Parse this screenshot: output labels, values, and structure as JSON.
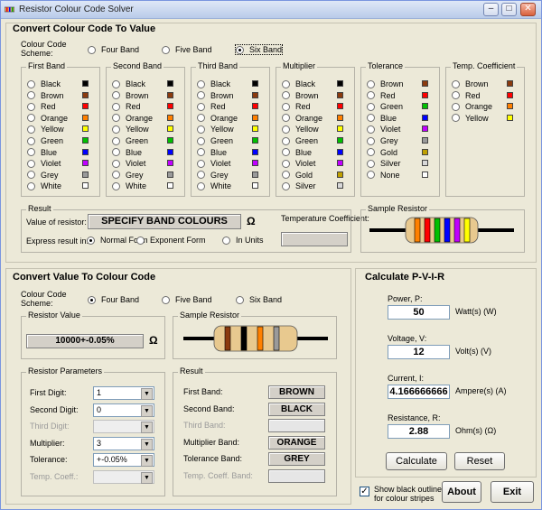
{
  "window": {
    "title": "Resistor Colour Code Solver"
  },
  "top": {
    "title": "Convert Colour Code To Value",
    "scheme_label": "Colour Code Scheme:",
    "schemes": [
      "Four Band",
      "Five Band",
      "Six Band"
    ],
    "selected_scheme": "Six Band",
    "groups": [
      {
        "title": "First Band",
        "items": [
          {
            "label": "Black",
            "color": "#000000"
          },
          {
            "label": "Brown",
            "color": "#8b3a0e"
          },
          {
            "label": "Red",
            "color": "#ff0000"
          },
          {
            "label": "Orange",
            "color": "#ff8000"
          },
          {
            "label": "Yellow",
            "color": "#ffff00"
          },
          {
            "label": "Green",
            "color": "#00c000"
          },
          {
            "label": "Blue",
            "color": "#0000ff"
          },
          {
            "label": "Violet",
            "color": "#c000ff"
          },
          {
            "label": "Grey",
            "color": "#9a9a9a"
          },
          {
            "label": "White",
            "color": "#ffffff"
          }
        ]
      },
      {
        "title": "Second Band",
        "items": [
          {
            "label": "Black",
            "color": "#000000"
          },
          {
            "label": "Brown",
            "color": "#8b3a0e"
          },
          {
            "label": "Red",
            "color": "#ff0000"
          },
          {
            "label": "Orange",
            "color": "#ff8000"
          },
          {
            "label": "Yellow",
            "color": "#ffff00"
          },
          {
            "label": "Green",
            "color": "#00c000"
          },
          {
            "label": "Blue",
            "color": "#0000ff"
          },
          {
            "label": "Violet",
            "color": "#c000ff"
          },
          {
            "label": "Grey",
            "color": "#9a9a9a"
          },
          {
            "label": "White",
            "color": "#ffffff"
          }
        ]
      },
      {
        "title": "Third Band",
        "items": [
          {
            "label": "Black",
            "color": "#000000"
          },
          {
            "label": "Brown",
            "color": "#8b3a0e"
          },
          {
            "label": "Red",
            "color": "#ff0000"
          },
          {
            "label": "Orange",
            "color": "#ff8000"
          },
          {
            "label": "Yellow",
            "color": "#ffff00"
          },
          {
            "label": "Green",
            "color": "#00c000"
          },
          {
            "label": "Blue",
            "color": "#0000ff"
          },
          {
            "label": "Violet",
            "color": "#c000ff"
          },
          {
            "label": "Grey",
            "color": "#9a9a9a"
          },
          {
            "label": "White",
            "color": "#ffffff"
          }
        ]
      },
      {
        "title": "Multiplier",
        "items": [
          {
            "label": "Black",
            "color": "#000000"
          },
          {
            "label": "Brown",
            "color": "#8b3a0e"
          },
          {
            "label": "Red",
            "color": "#ff0000"
          },
          {
            "label": "Orange",
            "color": "#ff8000"
          },
          {
            "label": "Yellow",
            "color": "#ffff00"
          },
          {
            "label": "Green",
            "color": "#00c000"
          },
          {
            "label": "Blue",
            "color": "#0000ff"
          },
          {
            "label": "Violet",
            "color": "#c000ff"
          },
          {
            "label": "Gold",
            "color": "#c0a000"
          },
          {
            "label": "Silver",
            "color": "#d8d8d8"
          }
        ]
      },
      {
        "title": "Tolerance",
        "items": [
          {
            "label": "Brown",
            "color": "#8b3a0e"
          },
          {
            "label": "Red",
            "color": "#ff0000"
          },
          {
            "label": "Green",
            "color": "#00c000"
          },
          {
            "label": "Blue",
            "color": "#0000ff"
          },
          {
            "label": "Violet",
            "color": "#c000ff"
          },
          {
            "label": "Grey",
            "color": "#9a9a9a"
          },
          {
            "label": "Gold",
            "color": "#c0a000"
          },
          {
            "label": "Silver",
            "color": "#d8d8d8"
          },
          {
            "label": "None",
            "color": "#ffffff"
          }
        ]
      },
      {
        "title": "Temp. Coefficient",
        "items": [
          {
            "label": "Brown",
            "color": "#8b3a0e"
          },
          {
            "label": "Red",
            "color": "#ff0000"
          },
          {
            "label": "Orange",
            "color": "#ff8000"
          },
          {
            "label": "Yellow",
            "color": "#ffff00"
          }
        ]
      }
    ],
    "result": {
      "title": "Result",
      "value_label": "Value of resistor:",
      "value": "SPECIFY BAND COLOURS",
      "unit": "Ω",
      "temp_label": "Temperature Coefficient:",
      "temp_value": "",
      "express_label": "Express result in:",
      "express_options": [
        "Normal Form",
        "Exponent Form",
        "In Units"
      ],
      "express_selected": "Normal Form"
    },
    "sample": {
      "title": "Sample Resistor",
      "bands": [
        "#ff8000",
        "#ff0000",
        "#00c000",
        "#0000ff",
        "#c000ff",
        "#ffff00"
      ]
    }
  },
  "bottom": {
    "title": "Convert Value To Colour Code",
    "scheme_label": "Colour Code Scheme:",
    "schemes": [
      "Four Band",
      "Five Band",
      "Six Band"
    ],
    "selected_scheme": "Four Band",
    "value_group": {
      "title": "Resistor Value",
      "value": "10000+-0.05%",
      "unit": "Ω"
    },
    "sample": {
      "title": "Sample Resistor",
      "bands": [
        "#8b3a0e",
        "#000000",
        "#ff8000",
        "#9a9a9a"
      ]
    },
    "params": {
      "title": "Resistor Parameters",
      "rows": [
        {
          "label": "First Digit:",
          "value": "1",
          "enabled": true
        },
        {
          "label": "Second Digit:",
          "value": "0",
          "enabled": true
        },
        {
          "label": "Third Digit:",
          "value": "",
          "enabled": false
        },
        {
          "label": "Multiplier:",
          "value": "3",
          "enabled": true
        },
        {
          "label": "Tolerance:",
          "value": "+-0.05%",
          "enabled": true
        },
        {
          "label": "Temp. Coeff.:",
          "value": "",
          "enabled": false
        }
      ]
    },
    "result": {
      "title": "Result",
      "rows": [
        {
          "label": "First Band:",
          "value": "BROWN",
          "enabled": true
        },
        {
          "label": "Second Band:",
          "value": "BLACK",
          "enabled": true
        },
        {
          "label": "Third Band:",
          "value": "",
          "enabled": false
        },
        {
          "label": "Multiplier Band:",
          "value": "ORANGE",
          "enabled": true
        },
        {
          "label": "Tolerance Band:",
          "value": "GREY",
          "enabled": true
        },
        {
          "label": "Temp. Coeff. Band:",
          "value": "",
          "enabled": false
        }
      ]
    }
  },
  "pvir": {
    "title": "Calculate P-V-I-R",
    "rows": [
      {
        "label": "Power, P:",
        "value": "50",
        "unit": "Watt(s) (W)"
      },
      {
        "label": "Voltage, V:",
        "value": "12",
        "unit": "Volt(s) (V)"
      },
      {
        "label": "Current, I:",
        "value": "4.166666666",
        "unit": "Ampere(s) (A)"
      },
      {
        "label": "Resistance, R:",
        "value": "2.88",
        "unit": "Ohm(s) (Ω)"
      }
    ],
    "calculate": "Calculate",
    "reset": "Reset"
  },
  "footer": {
    "outline_label_1": "Show black outline",
    "outline_label_2": "for colour stripes",
    "outline_checked": true,
    "about": "About",
    "exit": "Exit"
  }
}
